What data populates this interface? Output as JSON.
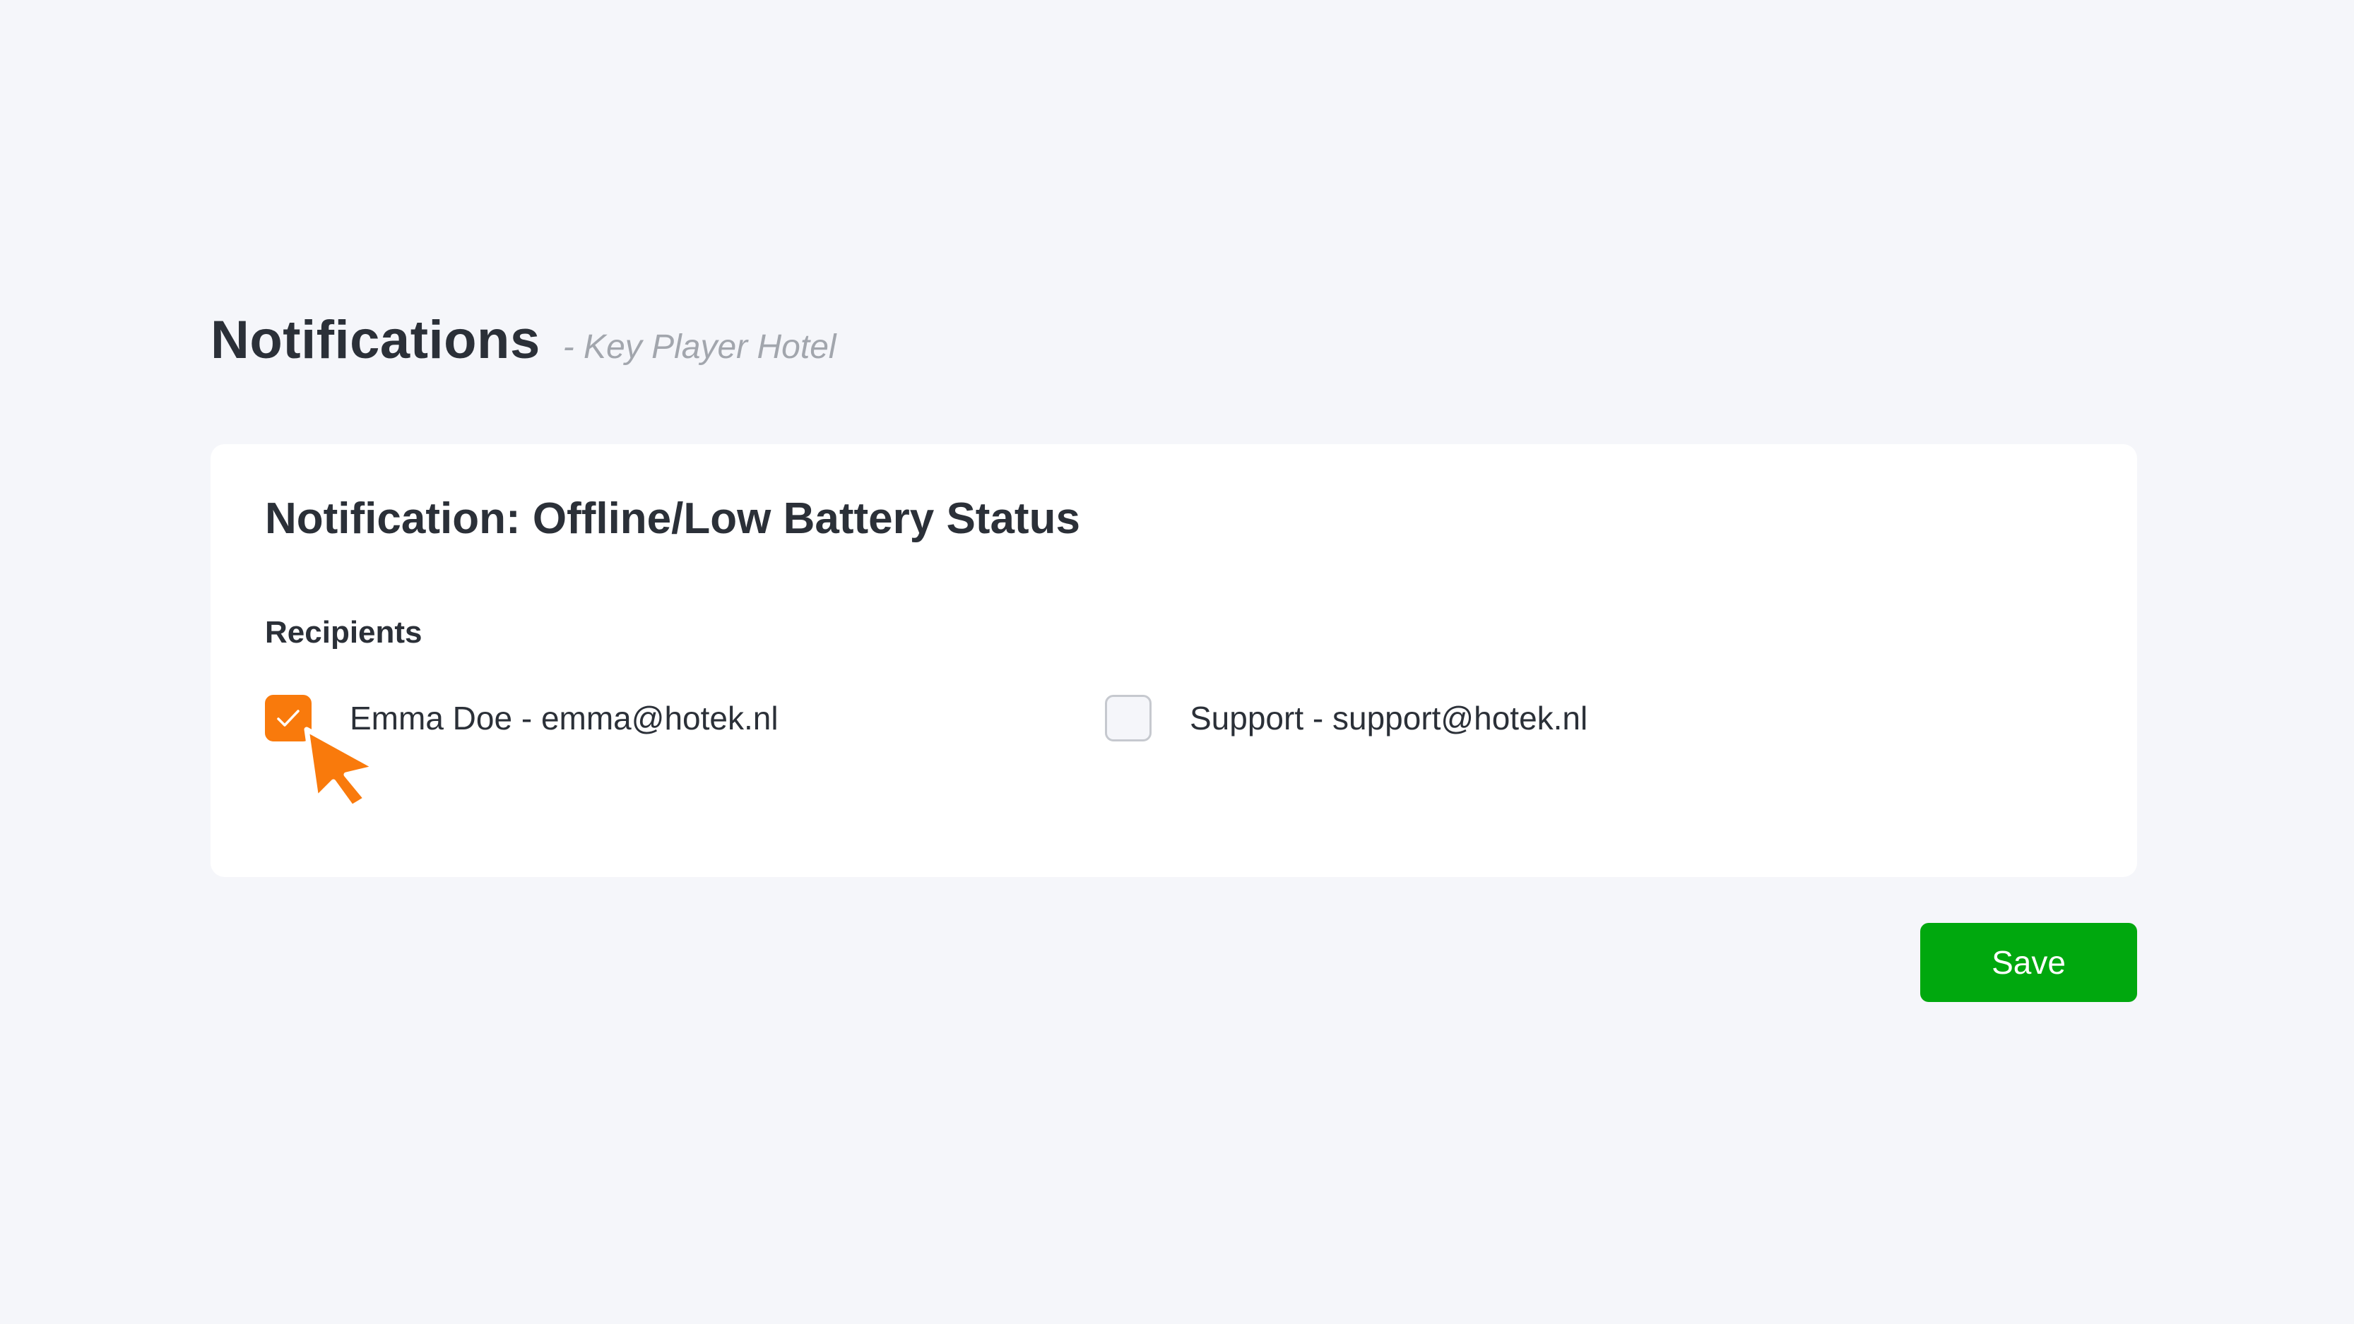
{
  "header": {
    "title": "Notifications",
    "subtitle": "- Key Player Hotel"
  },
  "card": {
    "title": "Notification: Offline/Low Battery Status",
    "recipients_label": "Recipients",
    "recipients": [
      {
        "label": "Emma Doe - emma@hotek.nl",
        "checked": true
      },
      {
        "label": "Support - support@hotek.nl",
        "checked": false
      }
    ]
  },
  "actions": {
    "save_label": "Save"
  },
  "colors": {
    "accent": "#f97a0c",
    "save": "#00a80e",
    "background": "#f5f6fa",
    "card": "#ffffff",
    "text": "#2b3038",
    "muted": "#a2a6ad"
  },
  "icons": {
    "checkmark": "check-icon",
    "cursor": "mouse-pointer-icon"
  }
}
